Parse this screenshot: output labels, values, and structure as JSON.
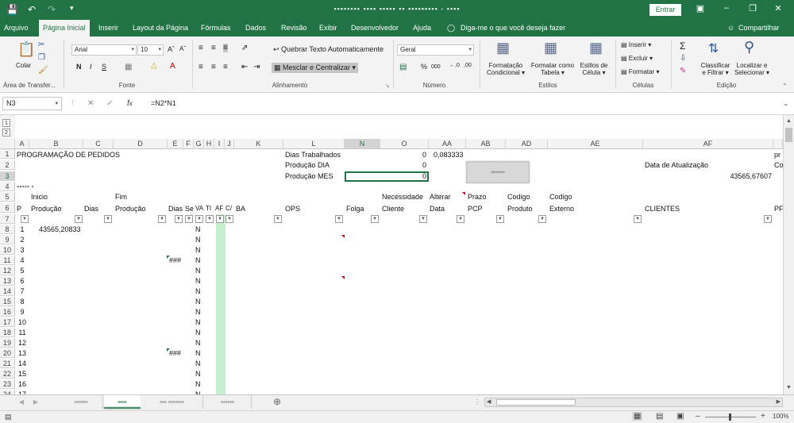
{
  "titlebar": {
    "doc_title": "▪▪▪▪▪▪▪▪ ▪▪▪▪ ▪▪▪▪▪ ▪▪ ▪▪▪▪▪▪▪▪▪ - ▪▪▪▪",
    "signin_label": "Entrar"
  },
  "menu": {
    "tabs": [
      "Arquivo",
      "Página Inicial",
      "Inserir",
      "Layout da Página",
      "Fórmulas",
      "Dados",
      "Revisão",
      "Exibir",
      "Desenvolvedor",
      "Ajuda"
    ],
    "tellme": "Diga-me o que você deseja fazer",
    "share": "Compartilhar"
  },
  "ribbon": {
    "clipboard": {
      "paste": "Colar",
      "group": "Área de Transfer..."
    },
    "font": {
      "name": "Arial",
      "size": "10",
      "group": "Fonte"
    },
    "alignment": {
      "wrap": "Quebrar Texto Automaticamente",
      "merge": "Mesclar e Centralizar",
      "group": "Alinhamento"
    },
    "number": {
      "format": "Geral",
      "group": "Número"
    },
    "styles": {
      "cond1": "Formatação",
      "cond2": "Condicional",
      "table1": "Formatar como",
      "table2": "Tabela",
      "cell1": "Estilos de",
      "cell2": "Célula",
      "group": "Estilos"
    },
    "cells": {
      "insert": "Inserir",
      "delete": "Excluir",
      "format": "Formatar",
      "group": "Células"
    },
    "editing": {
      "sort1": "Classificar",
      "sort2": "e Filtrar",
      "find1": "Localizar e",
      "find2": "Selecionar",
      "group": "Edição"
    }
  },
  "formula": {
    "namebox": "N3",
    "content": "=N2*N1"
  },
  "columns": [
    "A",
    "B",
    "C",
    "D",
    "E",
    "F",
    "G",
    "H",
    "I",
    "J",
    "K",
    "L",
    "N",
    "O",
    "AA",
    "AB",
    "AD",
    "AE",
    "AF"
  ],
  "row_numbers": [
    "1",
    "2",
    "3",
    "4",
    "5",
    "6",
    "7",
    "8",
    "9",
    "10",
    "11",
    "12",
    "13",
    "14",
    "15",
    "16",
    "17",
    "18",
    "19",
    "20",
    "21",
    "22",
    "23",
    "24"
  ],
  "cells": {
    "a1": "PROGRAMAÇÃO DE PEDIDOS",
    "l1": "Dias Trabalhados",
    "o1": "0",
    "aa1": "0,083333",
    "l2": "Produção DIA",
    "o2": "0",
    "af2": "Data de Atualização",
    "l3": "Produção MES",
    "o3": "0",
    "af3": "43565,67607",
    "a4": "▪▪▪▪▪ ▪",
    "b5": "Inicio",
    "d5": "Fim",
    "n5": "Necessidade",
    "o5": "Alterar",
    "aa5": "Prazo",
    "ab5": "Codigo",
    "ad5": "Codigo",
    "a6": "P",
    "b6": "Produção",
    "c6": "Dias",
    "d6": "Produção",
    "e6": "Dias",
    "f6": "Se",
    "g6": "VA",
    "h6": "TI",
    "i6": "AF",
    "j6": "C/",
    "k6": "BA",
    "l6": "OPS",
    "n6": "Folga",
    "o6": "Cliente",
    "aa6": "Data",
    "ab6": "PCP",
    "ad6": "Produto",
    "ae6": "Externo",
    "af6": "CLIENTES",
    "pr": "pr",
    "co": "Co",
    "p6": "PF",
    "b8": "43565,20833",
    "e_hash": "###",
    "g_n": "N",
    "button_blur": "▪▪▪▪▪▪▪"
  },
  "seq": [
    "1",
    "2",
    "3",
    "4",
    "5",
    "6",
    "7",
    "8",
    "9",
    "10",
    "11",
    "12",
    "13",
    "14",
    "15",
    "16",
    "17"
  ],
  "sheet_tabs": [
    "▪▪▪▪▪▪",
    "▪▪▪▪",
    "▪▪▪ ▪▪▪▪▪▪▪",
    "▪▪▪▪▪▪"
  ],
  "status": {
    "zoom": "100%"
  }
}
